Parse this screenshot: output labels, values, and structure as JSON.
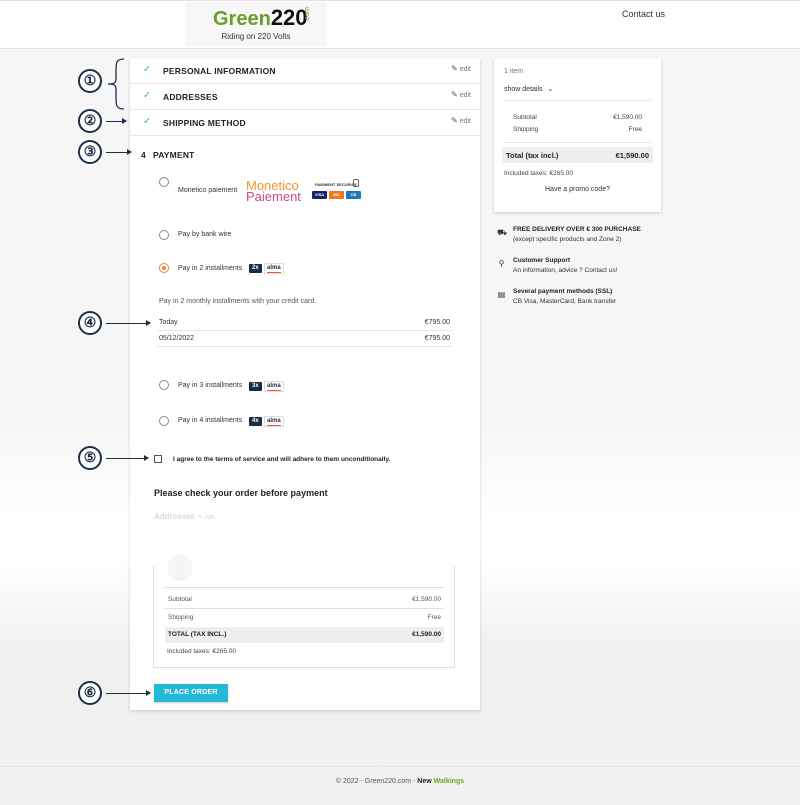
{
  "header": {
    "logo_green": "Green",
    "logo_number": "220",
    "logo_dotcom": ".com",
    "tagline": "Riding on 220 Volts",
    "contact": "Contact us"
  },
  "steps": {
    "personal": {
      "check": "✓",
      "title": "PERSONAL INFORMATION",
      "edit": "edit"
    },
    "addresses": {
      "check": "✓",
      "title": "ADDRESSES",
      "edit": "edit"
    },
    "shipping": {
      "check": "✓",
      "title": "SHIPPING METHOD",
      "edit": "edit"
    },
    "payment": {
      "number": "4",
      "title": "PAYMENT"
    }
  },
  "callouts": [
    "①",
    "②",
    "③",
    "④",
    "⑤",
    "⑥"
  ],
  "payment": {
    "monetico_label": "Monetico paiement",
    "monetico_brand_1": "Monetico",
    "monetico_brand_2": "Paiement",
    "secure_label": "PAIEMENT SECURISE",
    "card_visa": "VISA",
    "card_mc": "MC",
    "card_cb": "CB",
    "bank_wire": "Pay by bank wire",
    "two_installments": "Pay in 2 installments",
    "badge_2x": "2x",
    "badge_3x": "3x",
    "badge_4x": "4x",
    "alma": "alma",
    "installment_intro": "Pay in 2 monthly installments with your credit card.",
    "schedule": [
      {
        "date": "Today",
        "amount": "€795.00"
      },
      {
        "date": "05/12/2022",
        "amount": "€795.00"
      }
    ],
    "three_installments": "Pay in 3 installments",
    "four_installments": "Pay in 4 installments",
    "selected_option": "Pay in 2 installments"
  },
  "terms": "I agree to the terms of service and will adhere to them unconditionally.",
  "review": {
    "title": "Please check your order before payment",
    "addresses": "Addresses",
    "addresses_edit": "edit",
    "subtotal_label": "Subtotal",
    "subtotal_value": "€1,590.00",
    "shipping_label": "Shipping",
    "shipping_value": "Free",
    "total_label": "TOTAL (TAX INCL.)",
    "total_value": "€1,590.00",
    "taxes": "Included taxes: €265.00"
  },
  "place_order": "PLACE ORDER",
  "summary": {
    "item_count": "1 item",
    "show_details": "show details",
    "subtotal_label": "Subtotal",
    "subtotal_value": "€1,590.00",
    "shipping_label": "Shipping",
    "shipping_value": "Free",
    "total_label": "Total (tax incl.)",
    "total_value": "€1,590.00",
    "taxes": "Included taxes: €265.00",
    "promo": "Have a promo code?"
  },
  "reassurance": [
    {
      "icon": "truck-icon",
      "title": "FREE DELIVERY OVER € 300 PURCHASE",
      "text": "(except specific products and Zone 2)"
    },
    {
      "icon": "support-icon",
      "title": "Customer Support",
      "text": "An information, advice ? Contact us!"
    },
    {
      "icon": "credit-card-icon",
      "title": "Several payment methods (SSL)",
      "text": "CB Visa, MasterCard, Bank transfer"
    }
  ],
  "footer": {
    "copyright": "© 2022 - Green220.com - ",
    "new": "New",
    "walkings": "Walkings"
  },
  "colors": {
    "accent_button": "#24b9d7",
    "check_green": "#4cbb6c",
    "radio_selected": "#f47f33",
    "brand_green": "#6a9e2a",
    "callout_navy": "#1c2f48"
  }
}
